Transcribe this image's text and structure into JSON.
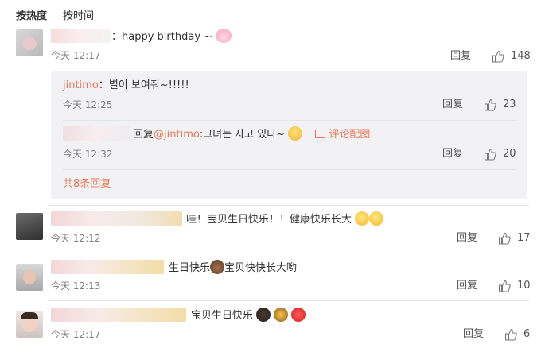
{
  "sort": {
    "hot": "按热度",
    "time": "按时间"
  },
  "comments": [
    {
      "text": "happy birthday ~",
      "prefix": "：",
      "time": "今天 12:17",
      "reply": "回复",
      "likes": "148"
    },
    {
      "text": "哇！宝贝生日快乐！！健康快乐长大",
      "time": "今天 12:12",
      "reply": "回复",
      "likes": "17"
    },
    {
      "text": "生日快乐",
      "text2": "宝贝快快长大哟",
      "time": "今天 12:13",
      "reply": "回复",
      "likes": "10"
    },
    {
      "text": "宝贝生日快乐",
      "time": "今天 12:17",
      "reply": "回复",
      "likes": "6"
    }
  ],
  "replies": [
    {
      "user": "jintimo",
      "sep": "：",
      "text": "별이 보여줘~!!!!!",
      "time": "今天 12:25",
      "reply": "回复",
      "likes": "23"
    },
    {
      "lead": "回复",
      "mention": "@jintimo",
      "text": ":그녀는 자고 있다~",
      "pic": "评论配图",
      "time": "今天 12:32",
      "reply": "回复",
      "likes": "20"
    }
  ],
  "more_replies": "共8条回复",
  "colors": {
    "link": "#eb7350",
    "reply_bg": "#f2f2f5",
    "time": "#808080"
  },
  "icons": [
    "thumbs-up-icon",
    "bunny-emoji",
    "laughing-emoji",
    "blush-emoji",
    "cake-emoji",
    "heart-emoji",
    "image-icon"
  ]
}
